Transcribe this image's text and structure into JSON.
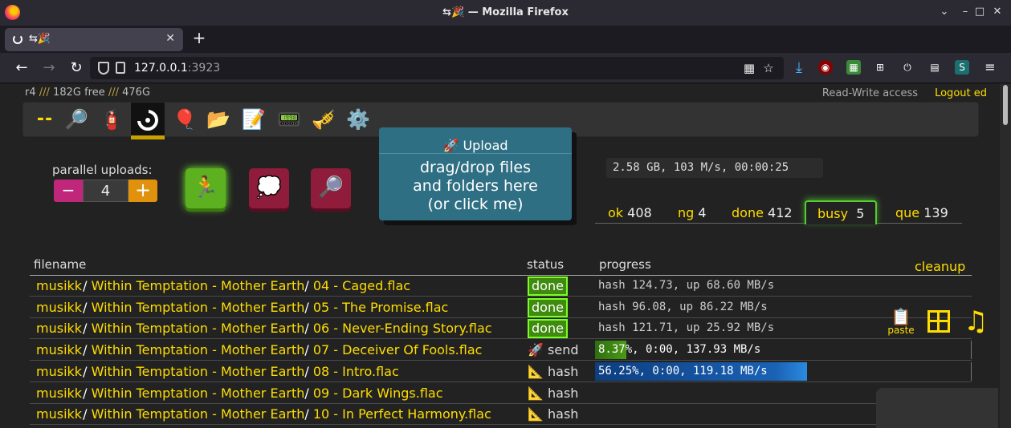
{
  "window": {
    "title": "⇆🎉 — Mozilla Firefox",
    "tab_label": "⇆🎉"
  },
  "urlbar": {
    "host": "127.0.0.1",
    "port": ":3923"
  },
  "ops": {
    "version": "r4",
    "sep": "///",
    "free": "182G free",
    "total": "476G"
  },
  "account": {
    "access": "Read-Write access",
    "logout": "Logout ed"
  },
  "iconbar": [
    "--",
    "search-icon",
    "extinguisher-icon",
    "upload-icon",
    "balloon-icon",
    "folder-icon",
    "memo-icon",
    "keyboard-icon",
    "trumpet-icon",
    "gear-icon"
  ],
  "uploads": {
    "label": "parallel uploads:",
    "value": "4",
    "minus": "−",
    "plus": "+"
  },
  "dropzone": {
    "title": "🚀 Upload",
    "line1": "drag/drop files",
    "line2": "and folders here",
    "line3": "(or click me)"
  },
  "speed": "2.58 GB, 103 M/s, 00:00:25",
  "tabs": [
    {
      "label": "ok",
      "count": "408"
    },
    {
      "label": "ng",
      "count": "4"
    },
    {
      "label": "done",
      "count": "412"
    },
    {
      "label": "busy",
      "count": "5"
    },
    {
      "label": "que",
      "count": "139"
    }
  ],
  "table": {
    "headers": {
      "filename": "filename",
      "status": "status",
      "progress": "progress"
    },
    "cleanup": "cleanup",
    "rows": [
      {
        "dir1": "musikk",
        "dir2": "Within Temptation - Mother Earth",
        "file": "04 - Caged.flac",
        "status": "done",
        "progress": "hash 124.73, up 68.60 MB/s"
      },
      {
        "dir1": "musikk",
        "dir2": "Within Temptation - Mother Earth",
        "file": "05 - The Promise.flac",
        "status": "done",
        "progress": "hash 96.08, up 86.22 MB/s"
      },
      {
        "dir1": "musikk",
        "dir2": "Within Temptation - Mother Earth",
        "file": "06 - Never-Ending Story.flac",
        "status": "done",
        "progress": "hash 121.71, up 25.92 MB/s"
      },
      {
        "dir1": "musikk",
        "dir2": "Within Temptation - Mother Earth",
        "file": "07 - Deceiver Of Fools.flac",
        "status": "🚀 send",
        "progress": "8.37%, 0:00, 137.93 MB/s",
        "fill": 0.0837
      },
      {
        "dir1": "musikk",
        "dir2": "Within Temptation - Mother Earth",
        "file": "08 - Intro.flac",
        "status": "📐 hash",
        "progress": "56.25%, 0:00, 119.18 MB/s",
        "fill": 0.5625
      },
      {
        "dir1": "musikk",
        "dir2": "Within Temptation - Mother Earth",
        "file": "09 - Dark Wings.flac",
        "status": "📐 hash",
        "progress": ""
      },
      {
        "dir1": "musikk",
        "dir2": "Within Temptation - Mother Earth",
        "file": "10 - In Perfect Harmony.flac",
        "status": "📐 hash",
        "progress": ""
      }
    ]
  },
  "dock": {
    "paste": "paste"
  },
  "colors": {
    "accent": "#ffdd00",
    "done": "#3f8a0f",
    "send_bar": "#4a9a14",
    "hash_bar": "#1a62b5",
    "dropzone": "#2f6f83"
  }
}
